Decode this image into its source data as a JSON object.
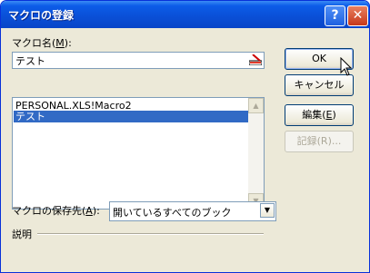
{
  "window": {
    "title": "マクロの登録"
  },
  "titlebar": {
    "help_label": "?",
    "close_label": "✕"
  },
  "macro_name": {
    "label_prefix": "マクロ名(",
    "label_key": "M",
    "label_suffix": "):",
    "value": "テスト"
  },
  "macro_list": {
    "items": [
      "PERSONAL.XLS!Macro2",
      "テスト"
    ],
    "selected": "テスト"
  },
  "buttons": {
    "ok": "OK",
    "cancel": "キャンセル",
    "edit_prefix": "編集(",
    "edit_key": "E",
    "edit_suffix": ")",
    "record": "記録(R)..."
  },
  "save_location": {
    "label_prefix": "マクロの保存先(",
    "label_key": "A",
    "label_suffix": "):",
    "value": "開いているすべてのブック"
  },
  "description": {
    "label": "説明"
  },
  "icons": [
    "help-icon",
    "close-icon",
    "collapse-dialog-icon",
    "scroll-up-icon",
    "scroll-down-icon",
    "dropdown-arrow-icon",
    "cursor-icon"
  ]
}
